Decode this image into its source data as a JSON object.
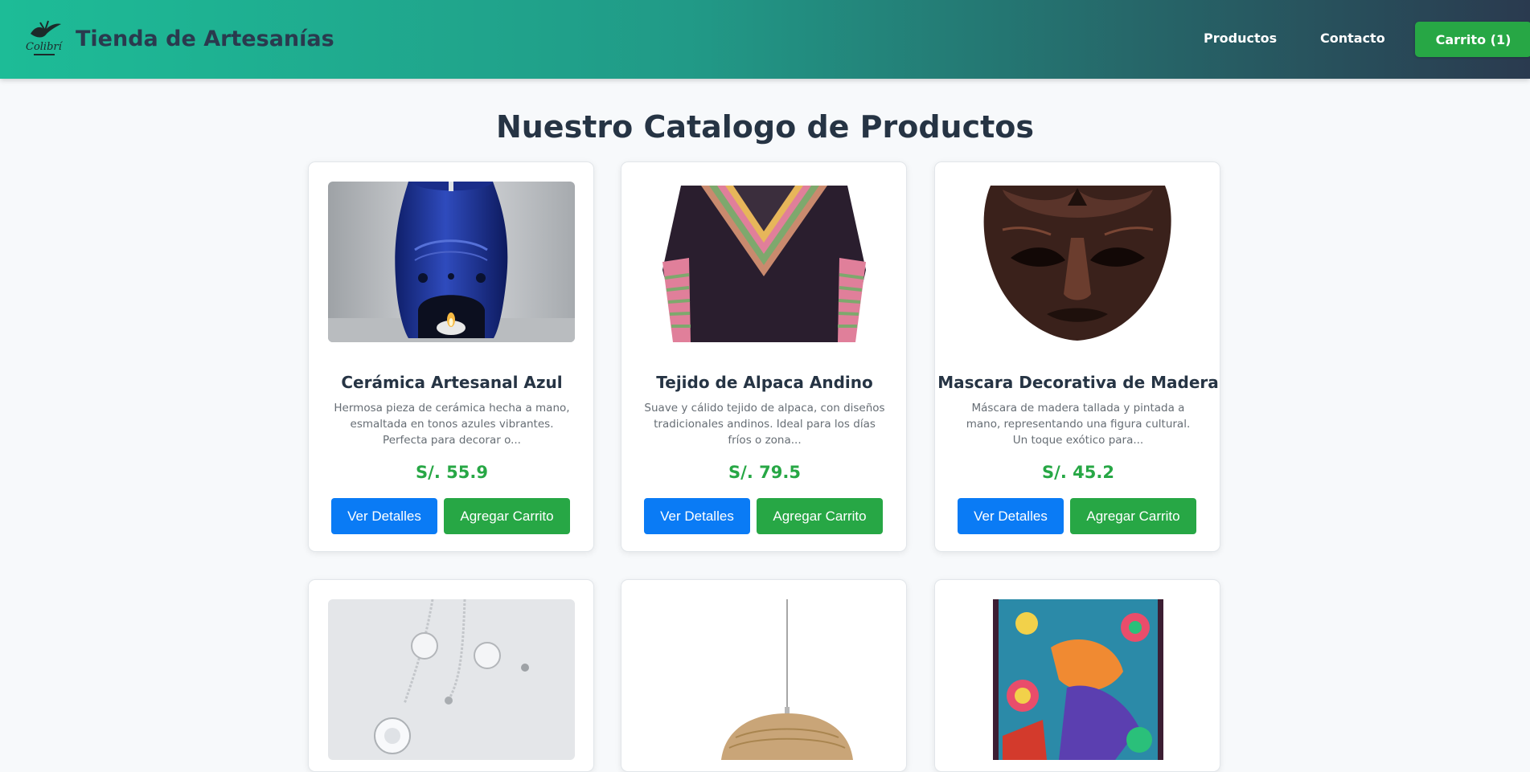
{
  "header": {
    "logo_text": "Colibrí",
    "title": "Tienda de Artesanías",
    "nav": {
      "productos": "Productos",
      "contacto": "Contacto"
    },
    "cart_label": "Carrito (1)"
  },
  "page_title": "Nuestro Catalogo de Productos",
  "buttons": {
    "details": "Ver Detalles",
    "add": "Agregar Carrito"
  },
  "products": [
    {
      "name": "Cerámica Artesanal Azul",
      "description": "Hermosa pieza de cerámica hecha a mano, esmaltada en tonos azules vibrantes. Perfecta para decorar o...",
      "price": "S/. 55.9"
    },
    {
      "name": "Tejido de Alpaca Andino",
      "description": "Suave y cálido tejido de alpaca, con diseños tradicionales andinos. Ideal para los días fríos o zona...",
      "price": "S/. 79.5"
    },
    {
      "name": "Mascara Decorativa de Madera",
      "description": "Máscara de madera tallada y pintada a mano, representando una figura cultural. Un toque exótico para...",
      "price": "S/. 45.2"
    }
  ]
}
